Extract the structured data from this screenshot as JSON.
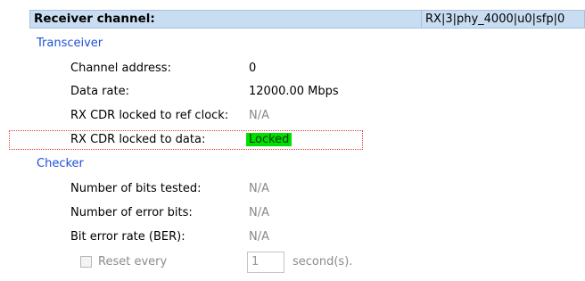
{
  "header": {
    "title": "Receiver channel:",
    "value": "RX|3|phy_4000|u0|sfp|0"
  },
  "transceiver": {
    "section_label": "Transceiver",
    "rows": [
      {
        "label": "Channel address:",
        "value": "0"
      },
      {
        "label": "Data rate:",
        "value": "12000.00 Mbps"
      },
      {
        "label": "RX CDR locked to ref clock:",
        "value": "N/A"
      },
      {
        "label": "RX CDR locked to data:",
        "value": "Locked"
      }
    ]
  },
  "checker": {
    "section_label": "Checker",
    "rows": [
      {
        "label": "Number of bits tested:",
        "value": "N/A"
      },
      {
        "label": "Number of error bits:",
        "value": "N/A"
      },
      {
        "label": "Bit error rate (BER):",
        "value": "N/A"
      }
    ]
  },
  "reset": {
    "label": "Reset every",
    "checked": false,
    "interval_value": "1",
    "unit": "second(s)."
  },
  "colors": {
    "header_bg": "#c9ddf2",
    "section_text": "#1e4fd6",
    "locked_bg": "#00e000",
    "highlight_border": "#e23b3b"
  }
}
